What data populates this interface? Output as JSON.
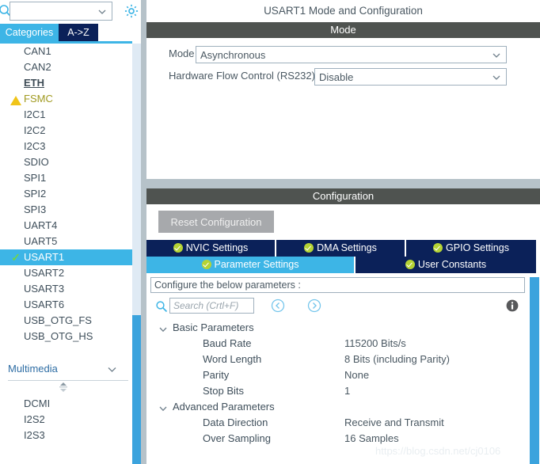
{
  "left_panel": {
    "search": {
      "icon": "search-icon",
      "value": "",
      "placeholder": "",
      "chevron": "chevron-down-icon"
    },
    "settings_gear": "gear-icon",
    "tabs": [
      {
        "label": "Categories",
        "active": true
      },
      {
        "label": "A->Z",
        "active": false
      }
    ],
    "peripherals": [
      {
        "label": "CAN1",
        "mark": "none",
        "state": "normal"
      },
      {
        "label": "CAN2",
        "mark": "none",
        "state": "normal"
      },
      {
        "label": "ETH",
        "mark": "none",
        "state": "link"
      },
      {
        "label": "FSMC",
        "mark": "warn",
        "state": "warn"
      },
      {
        "label": "I2C1",
        "mark": "none",
        "state": "normal"
      },
      {
        "label": "I2C2",
        "mark": "none",
        "state": "normal"
      },
      {
        "label": "I2C3",
        "mark": "none",
        "state": "normal"
      },
      {
        "label": "SDIO",
        "mark": "none",
        "state": "normal"
      },
      {
        "label": "SPI1",
        "mark": "none",
        "state": "normal"
      },
      {
        "label": "SPI2",
        "mark": "none",
        "state": "normal"
      },
      {
        "label": "SPI3",
        "mark": "none",
        "state": "normal"
      },
      {
        "label": "UART4",
        "mark": "none",
        "state": "normal"
      },
      {
        "label": "UART5",
        "mark": "none",
        "state": "normal"
      },
      {
        "label": "USART1",
        "mark": "check",
        "state": "selected"
      },
      {
        "label": "USART2",
        "mark": "none",
        "state": "normal"
      },
      {
        "label": "USART3",
        "mark": "none",
        "state": "normal"
      },
      {
        "label": "USART6",
        "mark": "none",
        "state": "normal"
      },
      {
        "label": "USB_OTG_FS",
        "mark": "none",
        "state": "normal"
      },
      {
        "label": "USB_OTG_HS",
        "mark": "none",
        "state": "normal"
      }
    ],
    "multimedia": {
      "label": "Multimedia",
      "chevron": "chevron-down-icon",
      "spinner": "scroll-up-down-icon",
      "items": [
        {
          "label": "DCMI"
        },
        {
          "label": "I2S2"
        },
        {
          "label": "I2S3"
        }
      ]
    }
  },
  "right_panel": {
    "title": "USART1 Mode and Configuration",
    "mode_section": {
      "header": "Mode",
      "fields": [
        {
          "label": "Mode",
          "value": "Asynchronous"
        },
        {
          "label": "Hardware Flow Control (RS232)",
          "value": "Disable"
        }
      ]
    },
    "configuration_section": {
      "header": "Configuration",
      "reset_button": "Reset Configuration",
      "tabs_row1": [
        {
          "label": "NVIC Settings",
          "checked": true,
          "active": false
        },
        {
          "label": "DMA Settings",
          "checked": true,
          "active": false
        },
        {
          "label": "GPIO Settings",
          "checked": true,
          "active": false
        }
      ],
      "tabs_row2": [
        {
          "label": "Parameter Settings",
          "checked": true,
          "active": true
        },
        {
          "label": "User Constants",
          "checked": true,
          "active": false
        }
      ],
      "hint": "Configure the below parameters :",
      "toolbar": {
        "search_icon": "search-icon",
        "search_value": "",
        "search_placeholder": "Search (Crtl+F)",
        "prev_icon": "chevron-left-circle-icon",
        "next_icon": "chevron-right-circle-icon",
        "info_icon": "info-icon"
      },
      "groups": [
        {
          "name": "Basic Parameters",
          "chevron": "chevron-down-icon",
          "rows": [
            {
              "name": "Baud Rate",
              "value": "115200 Bits/s"
            },
            {
              "name": "Word Length",
              "value": "8 Bits (including Parity)"
            },
            {
              "name": "Parity",
              "value": "None"
            },
            {
              "name": "Stop Bits",
              "value": "1"
            }
          ]
        },
        {
          "name": "Advanced Parameters",
          "chevron": "chevron-down-icon",
          "rows": [
            {
              "name": "Data Direction",
              "value": "Receive and Transmit"
            },
            {
              "name": "Over Sampling",
              "value": "16 Samples"
            }
          ]
        }
      ]
    }
  },
  "watermark": "https://blog.csdn.net/cj0106",
  "colors": {
    "accent_blue": "#3db5e6",
    "tab_navy": "#0b2159",
    "section_bar": "#4f5350",
    "warn_yellow": "#f0c419",
    "check_green": "#b5d334",
    "panel_gap": "#b6c2c9",
    "scrollbar": "#3ba3dd"
  }
}
